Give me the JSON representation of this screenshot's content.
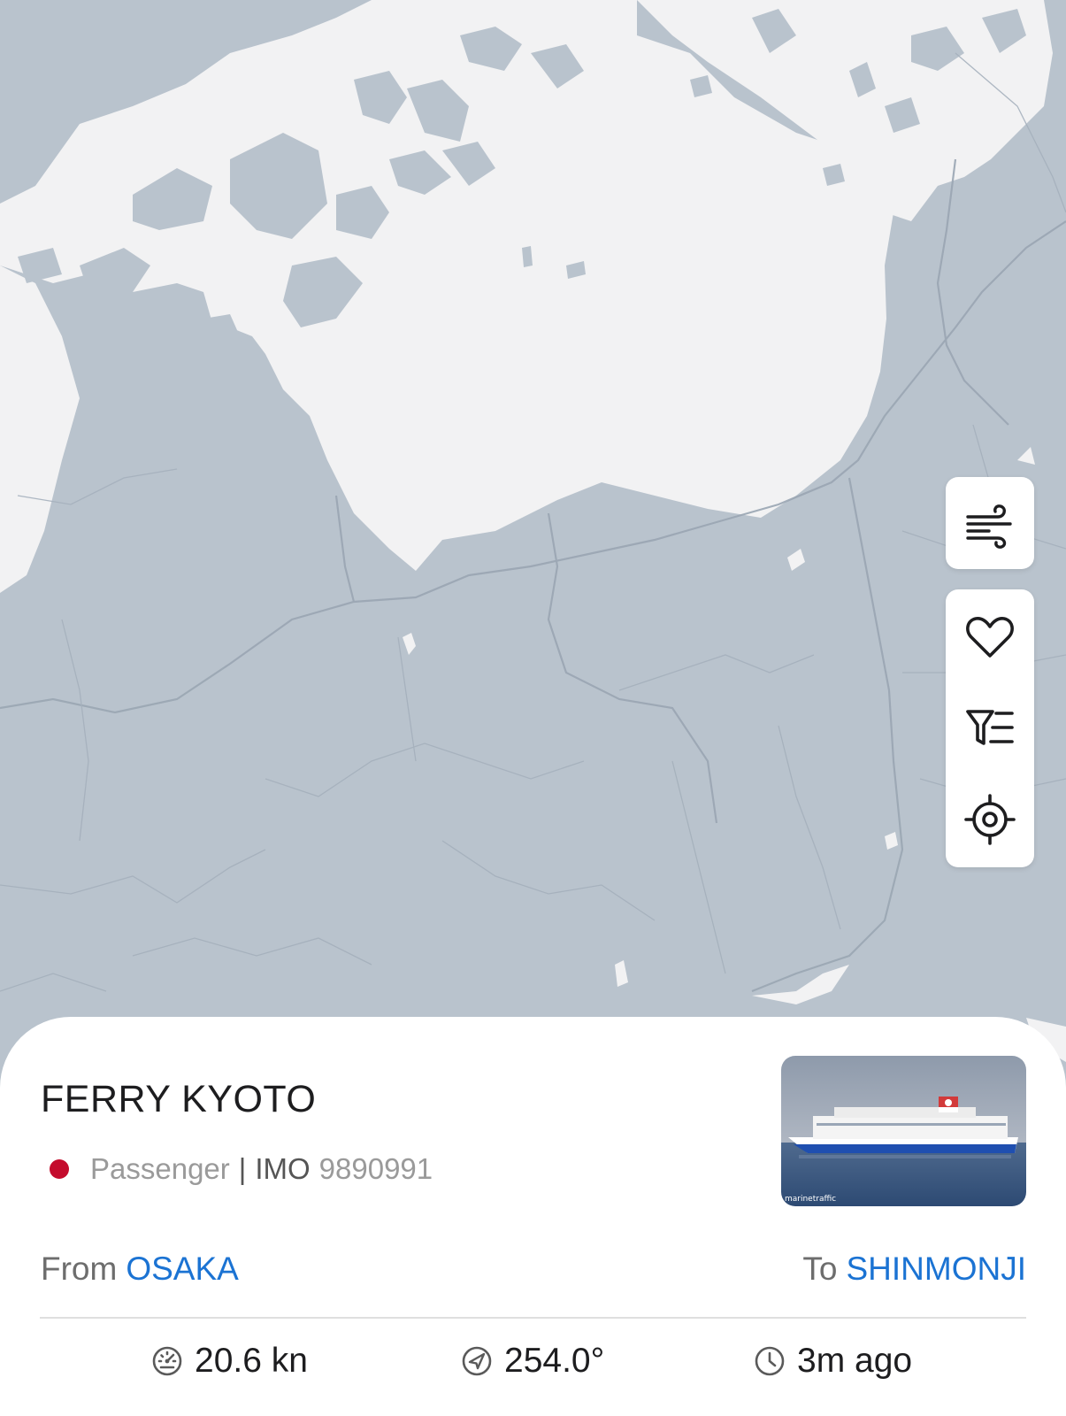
{
  "map": {
    "colors": {
      "land": "#b9c3cd",
      "water": "#f2f2f3",
      "roads": "#9aa6b3"
    }
  },
  "map_controls": [
    {
      "name": "weather-wind-button",
      "icon": "wind-icon"
    },
    {
      "name": "favorite-button",
      "icon": "heart-icon"
    },
    {
      "name": "filter-button",
      "icon": "filter-list-icon"
    },
    {
      "name": "locate-button",
      "icon": "crosshair-icon"
    }
  ],
  "vessel": {
    "name": "FERRY KYOTO",
    "type": "Passenger",
    "separator": "|",
    "imo_label": "IMO",
    "imo": "9890991",
    "flag_color": "#c40c2d",
    "photo_watermark": "marinetraffic"
  },
  "route": {
    "from_label": "From",
    "from_port": "OSAKA",
    "to_label": "To",
    "to_port": "SHINMONJI"
  },
  "stats": {
    "speed": "20.6 kn",
    "course": "254.0°",
    "last_seen": "3m ago"
  },
  "theme": {
    "accent": "#1b73d3",
    "text": "#1d1d1f",
    "muted": "#9a9a9a"
  }
}
